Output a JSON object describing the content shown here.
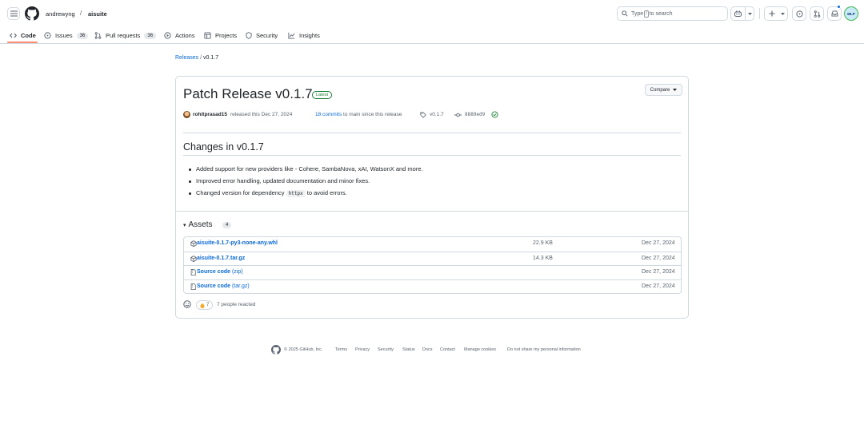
{
  "header": {
    "owner": "andrewyng",
    "separator": "/",
    "repo": "aisuite",
    "search": {
      "prefix": "Type",
      "key": "/",
      "suffix": "to search"
    },
    "avatar_text": "MLP"
  },
  "tabs": [
    {
      "label": "Code",
      "icon": "code-icon",
      "selected": true
    },
    {
      "label": "Issues",
      "icon": "issue-icon",
      "count": "36"
    },
    {
      "label": "Pull requests",
      "icon": "pull-request-icon",
      "count": "36"
    },
    {
      "label": "Actions",
      "icon": "play-icon"
    },
    {
      "label": "Projects",
      "icon": "table-icon"
    },
    {
      "label": "Security",
      "icon": "shield-icon"
    },
    {
      "label": "Insights",
      "icon": "graph-icon"
    }
  ],
  "breadcrumb": {
    "parent": "Releases",
    "sep": "/",
    "current": "v0.1.7"
  },
  "release": {
    "title": "Patch Release v0.1.7",
    "badge": "Latest",
    "compare_label": "Compare",
    "author": "rohitprasad15",
    "released_text": "released this Dec 27, 2024",
    "commits_link": "18 commits",
    "commits_suffix": "to main since this release",
    "tag": "v0.1.7",
    "sha": "8889ed9"
  },
  "changes": {
    "heading": "Changes in v0.1.7",
    "items": [
      "Added support for new providers like - Cohere, SambaNova, xAI, WatsonX and more.",
      "Improved error handling, updated documentation and minor fixes."
    ],
    "item3": {
      "before": "Changed version for dependency",
      "code": "httpx",
      "after": "to avoid errors."
    }
  },
  "assets": {
    "heading": "Assets",
    "count": "4",
    "rows": [
      {
        "name": "aisuite-0.1.7-py3-none-any.whl",
        "size": "22.9 KB",
        "date": "Dec 27, 2024",
        "icon": "package-icon"
      },
      {
        "name": "aisuite-0.1.7.tar.gz",
        "size": "14.3 KB",
        "date": "Dec 27, 2024",
        "icon": "package-icon"
      },
      {
        "name": "Source code",
        "sub": "(zip)",
        "size": "",
        "date": "Dec 27, 2024",
        "icon": "file-zip-icon"
      },
      {
        "name": "Source code",
        "sub": "(tar.gz)",
        "size": "",
        "date": "Dec 27, 2024",
        "icon": "file-zip-icon"
      }
    ]
  },
  "reactions": {
    "count": "7",
    "text": "7 people reacted"
  },
  "footer": {
    "copyright": "© 2025 GitHub, Inc.",
    "links": [
      "Terms",
      "Privacy",
      "Security",
      "Status",
      "Docs",
      "Contact",
      "Manage cookies",
      "Do not share my personal information"
    ]
  },
  "colors": {
    "link": "#0969da",
    "border": "#d1d9e0",
    "success": "#1a7f37",
    "tab_underline": "#fd8c73",
    "muted": "#59636e"
  }
}
